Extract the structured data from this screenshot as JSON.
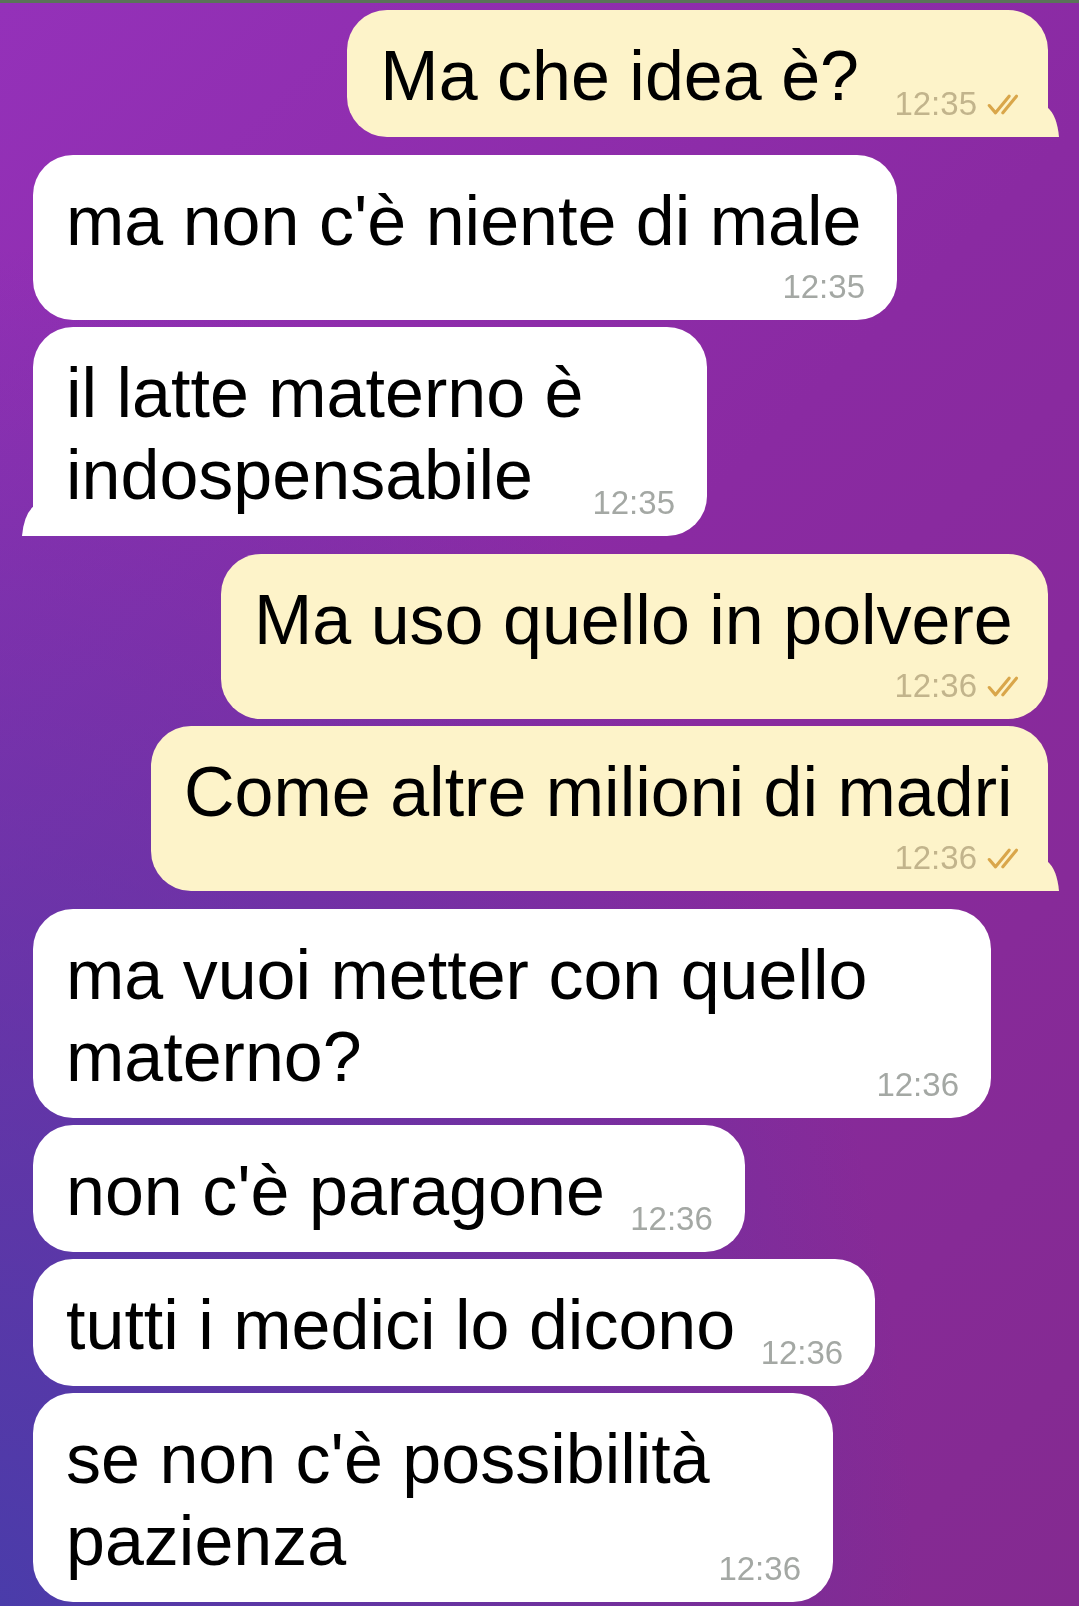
{
  "messages": [
    {
      "kind": "outgoing",
      "text": "Ma che idea è?",
      "time": "12:35",
      "read": true,
      "tail": true
    },
    {
      "kind": "incoming",
      "text": "ma non c'è niente di male",
      "time": "12:35",
      "tail": false
    },
    {
      "kind": "incoming",
      "text": "il latte materno è indospensabile",
      "time": "12:35",
      "tail": true
    },
    {
      "kind": "outgoing",
      "text": "Ma uso quello in polvere",
      "time": "12:36",
      "read": true,
      "tail": false
    },
    {
      "kind": "outgoing",
      "text": "Come altre milioni di madri",
      "time": "12:36",
      "read": true,
      "tail": true
    },
    {
      "kind": "incoming",
      "text": "ma vuoi metter con quello materno?",
      "time": "12:36",
      "tail": false
    },
    {
      "kind": "incoming",
      "text": "non c'è paragone",
      "time": "12:36",
      "tail": false
    },
    {
      "kind": "incoming",
      "text": "tutti i medici lo dicono",
      "time": "12:36",
      "tail": false
    },
    {
      "kind": "incoming",
      "text": "se non c'è possibilità pazienza",
      "time": "12:36",
      "tail": false
    }
  ]
}
